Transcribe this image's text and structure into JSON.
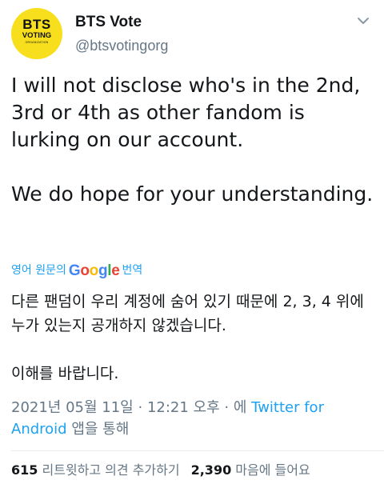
{
  "header": {
    "logo": {
      "line1": "BTS",
      "line2": "VOTING",
      "line3": "ORGANIZATION"
    },
    "display_name": "BTS Vote",
    "handle": "@btsvotingorg"
  },
  "tweet": {
    "paragraph1": "I will not disclose who's in the 2nd, 3rd or 4th as other fandom is lurking on our account.",
    "paragraph2": "We do hope for your understanding."
  },
  "translation": {
    "prefix": "영어 원문의",
    "google_letters": [
      "G",
      "o",
      "o",
      "g",
      "l",
      "e"
    ],
    "suffix": "번역",
    "paragraph1": "다른 팬덤이 우리 계정에 숨어 있기 때문에 2, 3, 4 위에 누가 있는지 공개하지 않겠습니다.",
    "paragraph2": "이해를 바랍니다."
  },
  "meta": {
    "date": "2021년 05월 11일",
    "sep1": "·",
    "time": "12:21 오후",
    "sep2": "·",
    "via": "에",
    "client": "Twitter for Android",
    "via_suffix": "앱을 통해"
  },
  "stats": {
    "retweets_count": "615",
    "retweets_label": "리트윗하고 의견 추가하기",
    "likes_count": "2,390",
    "likes_label": "마음에 들어요"
  },
  "colors": {
    "logo_bg": "#f7df1e",
    "link": "#1da1f2",
    "text": "#14171a",
    "secondary": "#657786"
  },
  "icons": {
    "more": "chevron-down-icon"
  }
}
